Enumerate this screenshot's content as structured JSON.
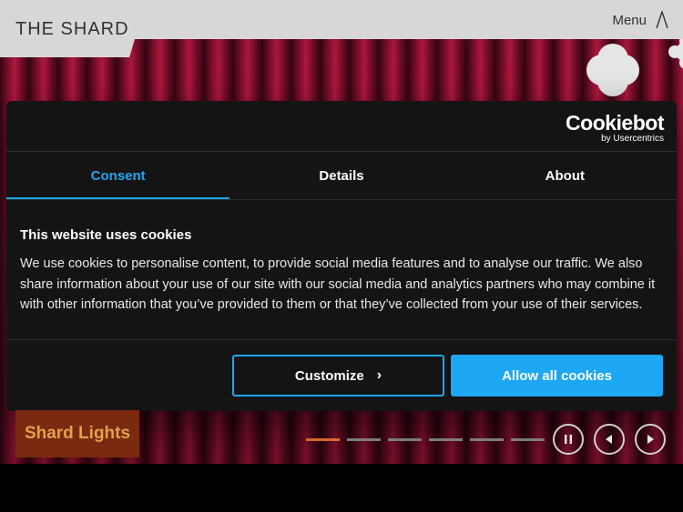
{
  "header": {
    "logo": "THE SHARD",
    "menu_label": "Menu"
  },
  "cookie_dialog": {
    "brand_name": "Cookiebot",
    "brand_sub": "by Usercentrics",
    "tabs": [
      {
        "label": "Consent",
        "active": true
      },
      {
        "label": "Details",
        "active": false
      },
      {
        "label": "About",
        "active": false
      }
    ],
    "title": "This website uses cookies",
    "body": "We use cookies to personalise content, to provide social media features and to analyse our traffic. We also share information about your use of our site with our social media and analytics partners who may combine it with other information that you’ve provided to them or that they’ve collected from your use of their services.",
    "customize_label": "Customize",
    "allow_all_label": "Allow all cookies",
    "accent_color": "#1ea7f2"
  },
  "hero": {
    "label": "Shard Lights",
    "slide_count": 6,
    "active_slide": 1
  },
  "icons": {
    "menu": "slash-menu-icon",
    "pause": "pause-icon",
    "prev": "play-left-icon",
    "next": "play-right-icon",
    "chevron": "chevron-right-icon"
  }
}
